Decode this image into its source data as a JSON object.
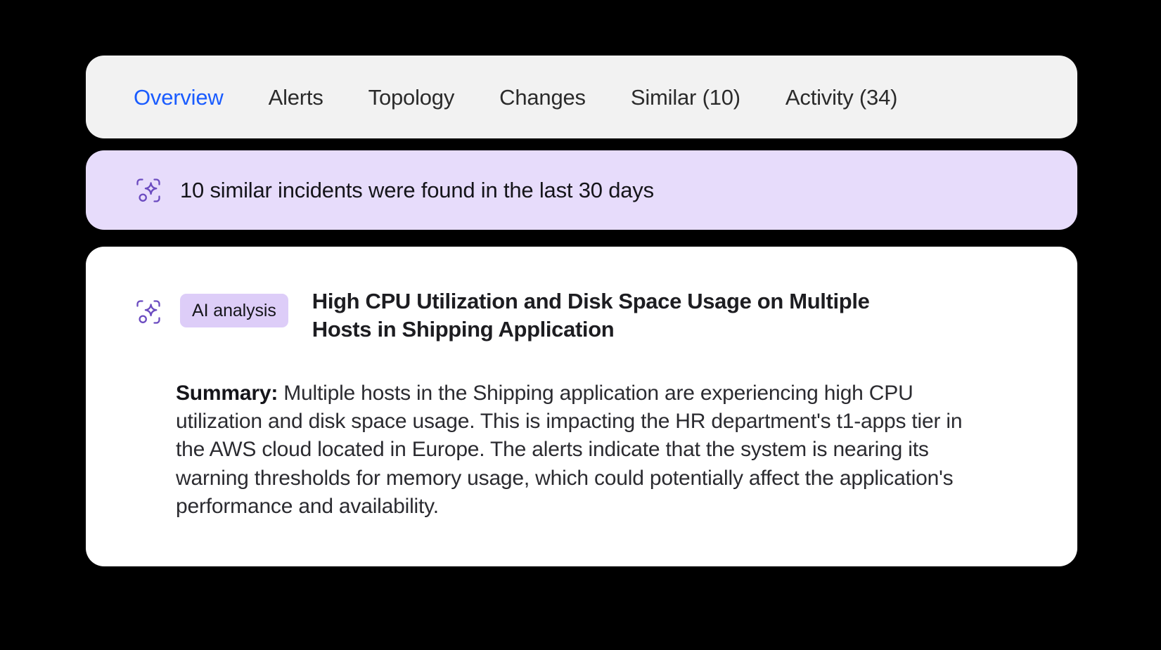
{
  "theme": {
    "page_background": "#000000",
    "tabs_card_background": "#f2f2f2",
    "banner_background": "#e7dcfb",
    "card_background": "#ffffff",
    "badge_background": "#ddcdf8",
    "accent_blue": "#1a5cff",
    "icon_purple": "#6b4bc0",
    "text_primary": "#15151a"
  },
  "tabs": [
    {
      "label": "Overview",
      "active": true
    },
    {
      "label": "Alerts",
      "active": false
    },
    {
      "label": "Topology",
      "active": false
    },
    {
      "label": "Changes",
      "active": false
    },
    {
      "label": "Similar (10)",
      "active": false
    },
    {
      "label": "Activity (34)",
      "active": false
    }
  ],
  "banner": {
    "icon": "ai-sparkle-icon",
    "text": "10 similar incidents were found in the last 30 days"
  },
  "card": {
    "icon": "ai-sparkle-icon",
    "badge": "AI analysis",
    "title": "High CPU Utilization and Disk Space Usage on Multiple Hosts in Shipping Application",
    "summary_label": "Summary:",
    "summary_body": " Multiple hosts in the Shipping application are experiencing high CPU utilization and disk space usage. This is impacting the HR department's t1-apps tier in the AWS cloud located in Europe. The alerts indicate that the system is nearing its warning thresholds for memory usage, which could potentially affect the application's performance and availability."
  }
}
